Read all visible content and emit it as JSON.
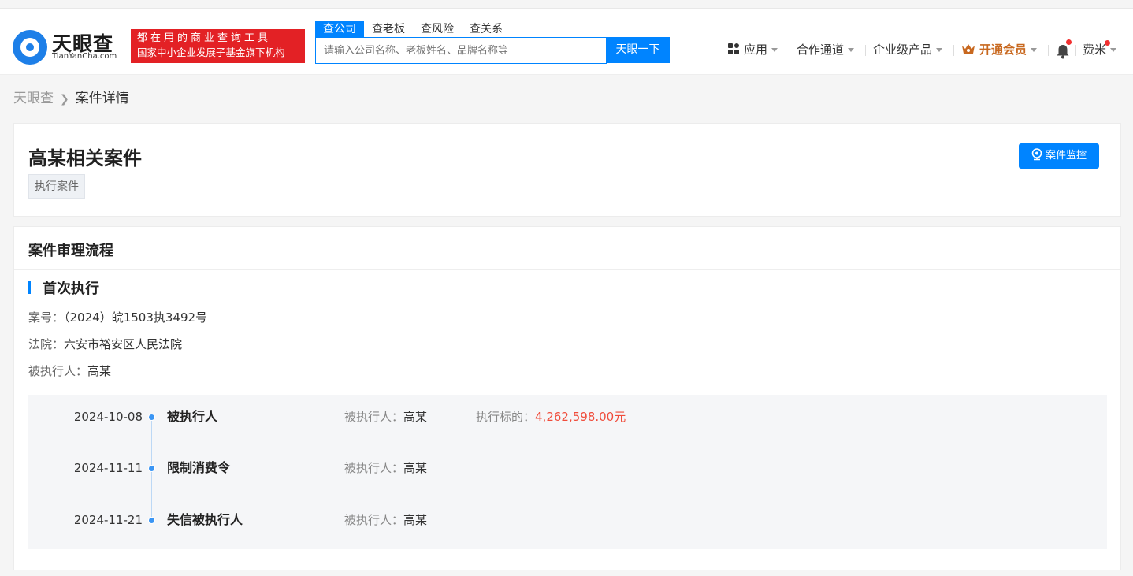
{
  "header": {
    "logo_cn": "天眼查",
    "logo_en": "TianYanCha.com",
    "slogan_line1": "都在用的商业查询工具",
    "slogan_line2": "国家中小企业发展子基金旗下机构",
    "search_tabs": [
      "查公司",
      "查老板",
      "查风险",
      "查关系"
    ],
    "search_placeholder": "请输入公司名称、老板姓名、品牌名称等",
    "search_button": "天眼一下",
    "nav": {
      "apps": "应用",
      "cooperation": "合作通道",
      "enterprise": "企业级产品",
      "vip": "开通会员",
      "user": "费米"
    },
    "accent_color": "#0084ff",
    "vip_color": "#c8681f"
  },
  "breadcrumb": {
    "home": "天眼查",
    "current": "案件详情"
  },
  "case": {
    "title": "高某相关案件",
    "tag": "执行案件",
    "monitor_button": "案件监控"
  },
  "process": {
    "section_title": "案件审理流程",
    "stage_title": "首次执行",
    "case_no_label": "案号：",
    "case_no": "（2024）皖1503执3492号",
    "court_label": "法院：",
    "court": "六安市裕安区人民法院",
    "defendant_label": "被执行人：",
    "defendant": "高某",
    "timeline": [
      {
        "date": "2024-10-08",
        "event": "被执行人",
        "party_label": "被执行人：",
        "party": "高某",
        "amount_label": "执行标的：",
        "amount": "4,262,598.00元"
      },
      {
        "date": "2024-11-11",
        "event": "限制消费令",
        "party_label": "被执行人：",
        "party": "高某"
      },
      {
        "date": "2024-11-21",
        "event": "失信被执行人",
        "party_label": "被执行人：",
        "party": "高某"
      }
    ]
  }
}
